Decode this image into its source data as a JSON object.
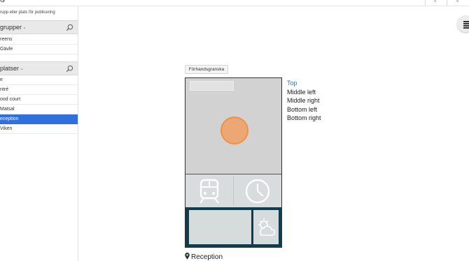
{
  "topbar": {
    "crumb": "G"
  },
  "sidebar": {
    "hint": "rupp eller plats för publicering",
    "groups": {
      "title": "grupper",
      "items": [
        {
          "label": "reens"
        },
        {
          "label": "Gävle"
        }
      ]
    },
    "places": {
      "title": "platser",
      "items": [
        {
          "label": "e",
          "selected": false
        },
        {
          "label": "ntré",
          "selected": false
        },
        {
          "label": "ood court",
          "selected": false
        },
        {
          "label": "Matsal",
          "selected": false
        },
        {
          "label": "eception",
          "selected": true
        },
        {
          "label": "Viken",
          "selected": false
        }
      ]
    }
  },
  "preview": {
    "button_label": "Förhandsgranska",
    "zones": [
      {
        "label": "Top",
        "active": true
      },
      {
        "label": "Middle left",
        "active": false
      },
      {
        "label": "Middle right",
        "active": false
      },
      {
        "label": "Bottom left",
        "active": false
      },
      {
        "label": "Bottom right",
        "active": false
      }
    ],
    "place_name": "Reception"
  },
  "colors": {
    "accent": "#2f6fde",
    "highlight_circle": "#eca774",
    "highlight_circle_border": "#ef9142",
    "bottom_bar": "#0e3d50",
    "zone_link": "#2f73d6"
  },
  "icons": {
    "menu": "hamburger-menu-icon",
    "search": "magnifier-icon",
    "chevron": "chevron-down-icon",
    "train": "train-icon",
    "clock": "clock-icon",
    "weather": "sun-cloud-icon",
    "pin": "location-pin-icon"
  }
}
